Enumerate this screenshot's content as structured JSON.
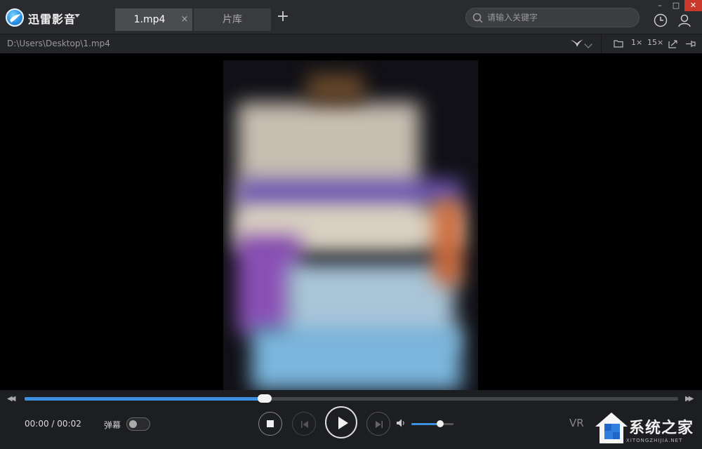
{
  "app": {
    "name": "迅雷影音"
  },
  "tabs": [
    {
      "label": "1.mp4",
      "active": true,
      "close": "×"
    },
    {
      "label": "片库",
      "active": false
    }
  ],
  "add_tab": "+",
  "search": {
    "placeholder": "请输入关键字"
  },
  "window_controls": {
    "minimize": "–",
    "maximize": "□",
    "close": "✕"
  },
  "pathbar": {
    "path": "D:\\Users\\Desktop\\1.mp4",
    "speed_1x": "1×",
    "speed_15x": "15×"
  },
  "controls": {
    "rewind": "◀◀",
    "fast_forward": "▶▶",
    "current_time": "00:00",
    "separator": "/",
    "duration": "00:02",
    "time_display": "00:00 / 00:02",
    "progress_fraction": 0.367,
    "danmu_label": "弹幕",
    "danmu_on": false,
    "volume_fraction": 0.68,
    "vr_label": "VR"
  },
  "watermark": {
    "title": "系统之家",
    "url": "XITONGZHIJIA.NET"
  },
  "colors": {
    "accent": "#3d8fe0",
    "titlebar": "#2a2b2e",
    "close": "#c8392b"
  }
}
